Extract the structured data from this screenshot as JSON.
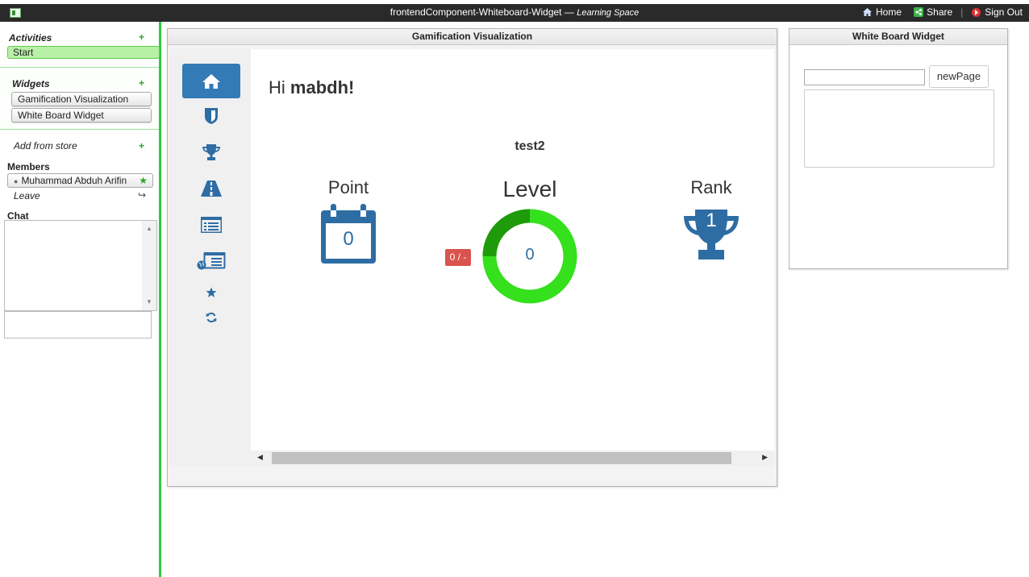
{
  "topbar": {
    "title": "frontendComponent-Whiteboard-Widget —",
    "space": "Learning Space",
    "home": "Home",
    "share": "Share",
    "separator": "|",
    "signout": "Sign Out"
  },
  "sidebar": {
    "activities_label": "Activities",
    "plus": "+",
    "start": "Start",
    "widgets_label": "Widgets",
    "widgets": [
      "Gamification Visualization",
      "White Board Widget"
    ],
    "add_from_store": "Add from store",
    "members_label": "Members",
    "member": "Muhammad Abduh Arifin",
    "member_star": "★",
    "leave": "Leave",
    "leave_icon": "↪",
    "chat_label": "Chat"
  },
  "gamification": {
    "title": "Gamification Visualization",
    "greeting_prefix": "Hi ",
    "username": "mabdh!",
    "subtitle": "test2",
    "point_label": "Point",
    "point_value": "0",
    "level_label": "Level",
    "level_value": "0",
    "level_badge": "0 / -",
    "level_progress": 0.25,
    "rank_label": "Rank",
    "rank_value": "1",
    "nav_icons": [
      "home-icon",
      "badge-icon",
      "trophy-icon",
      "road-icon",
      "list-icon",
      "global-list-icon",
      "star-icon",
      "refresh-icon"
    ],
    "colors": {
      "primary": "#337ab7",
      "gauge": "#2ecc11",
      "badge": "#d9534f",
      "icon": "#2e6da4"
    }
  },
  "whiteboard": {
    "title": "White Board Widget",
    "input_value": "",
    "new_page": "newPage",
    "text_value": ""
  }
}
